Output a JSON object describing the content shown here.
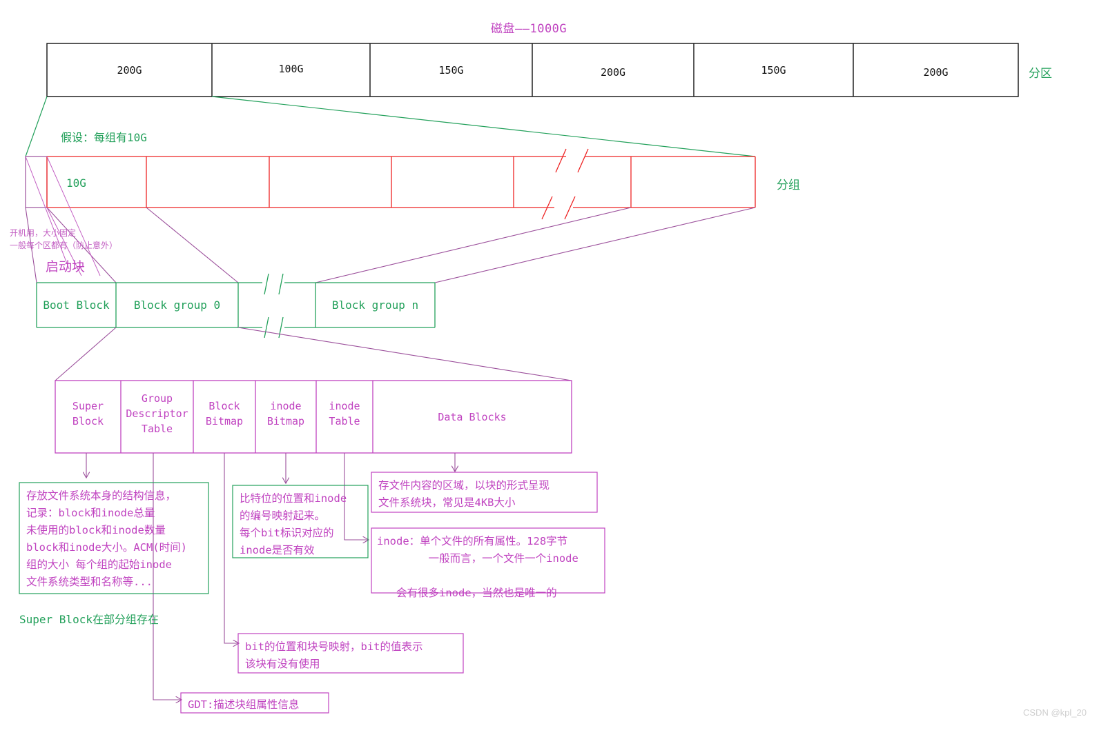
{
  "disk": {
    "title": "磁盘——1000G",
    "side_label": "分区",
    "partitions": [
      {
        "label": "200G"
      },
      {
        "label": "100G"
      },
      {
        "label": "150G"
      },
      {
        "label": "200G"
      },
      {
        "label": "150G"
      },
      {
        "label": "200G"
      }
    ]
  },
  "groups": {
    "assumption": "假设：每组有10G",
    "first_cell": "10G",
    "side_label": "分组"
  },
  "boot": {
    "note_line1": "开机用，大小固定",
    "note_line2": "一般每个区都有（防止意外）",
    "title": "启动块",
    "cells": [
      {
        "label": "Boot Block"
      },
      {
        "label": "Block group 0"
      },
      {
        "label": ""
      },
      {
        "label": "Block group n"
      }
    ]
  },
  "detail": {
    "cells": [
      {
        "label": "Super\nBlock"
      },
      {
        "label": "Group\nDescriptor\nTable"
      },
      {
        "label": "Block\nBitmap"
      },
      {
        "label": "inode\nBitmap"
      },
      {
        "label": "inode\nTable"
      },
      {
        "label": "Data Blocks"
      }
    ]
  },
  "callouts": {
    "super_block": "存放文件系统本身的结构信息，\n记录：block和inode总量\n未使用的block和inode数量\nblock和inode大小。ACM(时间)\n组的大小 每个组的起始inode\n文件系统类型和名称等...",
    "super_block_note": "Super Block在部分组存在",
    "inode_bitmap": "比特位的位置和inode\n的编号映射起来。\n每个bit标识对应的\ninode是否有效",
    "data_blocks": "存文件内容的区域，以块的形式呈现\n文件系统块，常见是4KB大小",
    "inode_table": "inode：单个文件的所有属性。128字节\n        一般而言，一个文件一个inode\n\n   会有很多inode，当然也是唯一的",
    "block_bitmap": "bit的位置和块号映射，bit的值表示\n该块有没有使用",
    "gdt": "GDT:描述块组属性信息"
  },
  "watermark": "CSDN @kpl_20",
  "colors": {
    "magenta": "#c043c0",
    "green": "#22a05a",
    "red": "#ee2222",
    "purple_line": "#9b4f9b",
    "black": "#111111"
  }
}
